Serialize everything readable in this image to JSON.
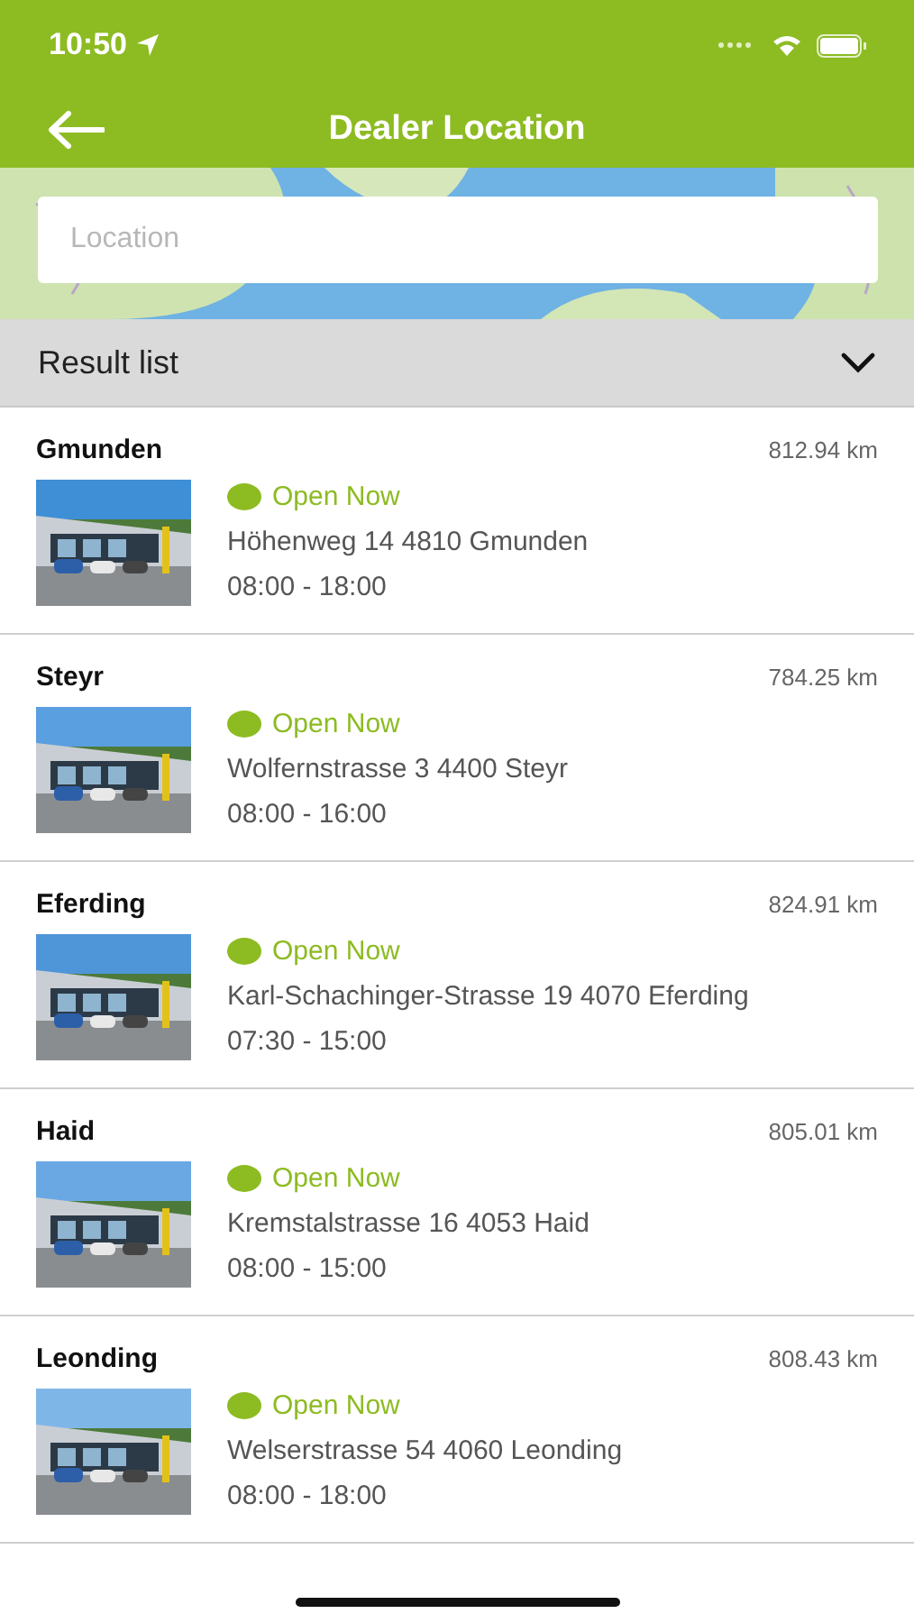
{
  "status_bar": {
    "time": "10:50"
  },
  "header": {
    "title": "Dealer Location"
  },
  "search": {
    "placeholder": "Location"
  },
  "result_list": {
    "title": "Result list",
    "expanded": true
  },
  "dealers": [
    {
      "name": "Gmunden",
      "distance": "812.94 km",
      "status": "Open Now",
      "open": true,
      "address": "Höhenweg 14 4810 Gmunden",
      "hours": "08:00 - 18:00"
    },
    {
      "name": "Steyr",
      "distance": "784.25 km",
      "status": "Open Now",
      "open": true,
      "address": "Wolfernstrasse 3 4400 Steyr",
      "hours": "08:00 - 16:00"
    },
    {
      "name": "Eferding",
      "distance": "824.91 km",
      "status": "Open Now",
      "open": true,
      "address": "Karl-Schachinger-Strasse 19 4070 Eferding",
      "hours": "07:30 - 15:00"
    },
    {
      "name": "Haid",
      "distance": "805.01 km",
      "status": "Open Now",
      "open": true,
      "address": "Kremstalstrasse 16 4053 Haid",
      "hours": "08:00 - 15:00"
    },
    {
      "name": "Leonding",
      "distance": "808.43 km",
      "status": "Open Now",
      "open": true,
      "address": "Welserstrasse 54 4060 Leonding",
      "hours": "08:00 - 18:00"
    }
  ]
}
